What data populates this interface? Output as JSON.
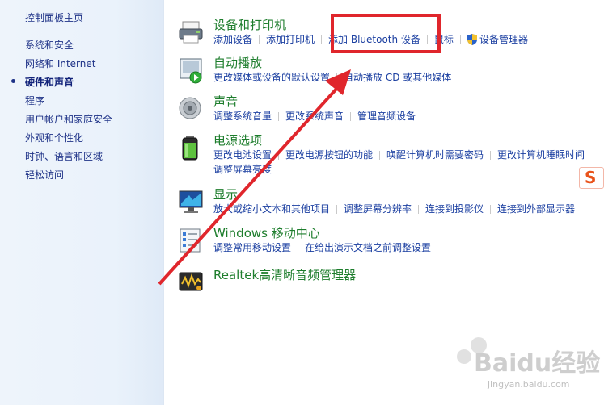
{
  "sidebar": {
    "items": [
      {
        "label": "控制面板主页"
      },
      {
        "label": "系统和安全"
      },
      {
        "label": "网络和 Internet"
      },
      {
        "label": "硬件和声音",
        "current": true
      },
      {
        "label": "程序"
      },
      {
        "label": "用户帐户和家庭安全"
      },
      {
        "label": "外观和个性化"
      },
      {
        "label": "时钟、语言和区域"
      },
      {
        "label": "轻松访问"
      }
    ]
  },
  "categories": [
    {
      "title": "设备和打印机",
      "icon": "printer-icon",
      "links": [
        "添加设备",
        "添加打印机",
        "添加 Bluetooth 设备",
        "鼠标",
        "设备管理器"
      ]
    },
    {
      "title": "自动播放",
      "icon": "autoplay-icon",
      "links": [
        "更改媒体或设备的默认设置",
        "自动播放 CD 或其他媒体"
      ]
    },
    {
      "title": "声音",
      "icon": "speaker-icon",
      "links": [
        "调整系统音量",
        "更改系统声音",
        "管理音频设备"
      ]
    },
    {
      "title": "电源选项",
      "icon": "battery-icon",
      "links": [
        "更改电池设置",
        "更改电源按钮的功能",
        "唤醒计算机时需要密码",
        "更改计算机睡眠时间",
        "调整屏幕亮度"
      ]
    },
    {
      "title": "显示",
      "icon": "monitor-icon",
      "links": [
        "放大或缩小文本和其他项目",
        "调整屏幕分辨率",
        "连接到投影仪",
        "连接到外部显示器"
      ]
    },
    {
      "title": "Windows 移动中心",
      "icon": "mobility-center-icon",
      "links": [
        "调整常用移动设置",
        "在给出演示文档之前调整设置"
      ]
    },
    {
      "title": "Realtek高清晰音频管理器",
      "icon": "realtek-audio-icon",
      "links": []
    }
  ],
  "overlay": {
    "highlight_color": "#e0262c",
    "ime_badge": "S",
    "watermark_logo": "Baidu经验",
    "watermark_url": "jingyan.baidu.com"
  },
  "colors": {
    "title_green": "#1d7d2c",
    "link_blue": "#1a3ea0",
    "sidebar_text": "#1e3287"
  }
}
